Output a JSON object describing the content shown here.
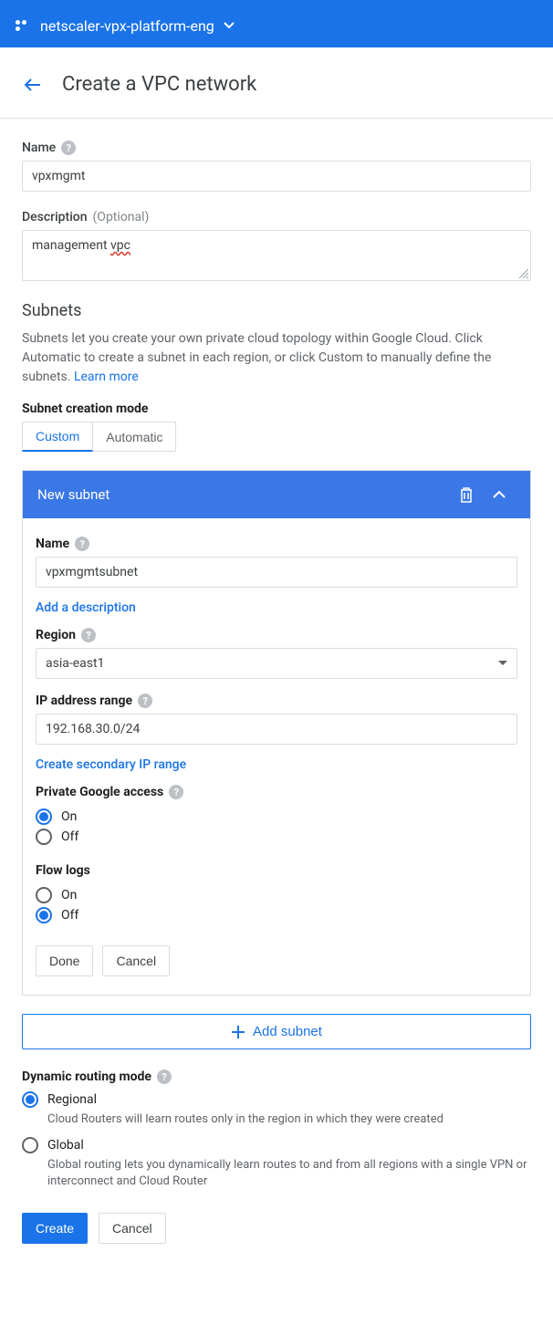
{
  "header": {
    "project": "netscaler-vpx-platform-eng",
    "page_title": "Create a VPC network"
  },
  "name_field": {
    "label": "Name",
    "value": "vpxmgmt"
  },
  "description_field": {
    "label": "Description",
    "optional": "(Optional)",
    "value_pre": "management ",
    "value_err": "vpc"
  },
  "subnets": {
    "title": "Subnets",
    "help": "Subnets let you create your own private cloud topology within Google Cloud. Click Automatic to create a subnet in each region, or click Custom to manually define the subnets. ",
    "learn_more": "Learn more",
    "mode_label": "Subnet creation mode",
    "mode_custom": "Custom",
    "mode_automatic": "Automatic"
  },
  "new_subnet": {
    "header": "New subnet",
    "name_label": "Name",
    "name_value": "vpxmgmtsubnet",
    "add_desc": "Add a description",
    "region_label": "Region",
    "region_value": "asia-east1",
    "ip_label": "IP address range",
    "ip_value": "192.168.30.0/24",
    "secondary": "Create secondary IP range",
    "pga_label": "Private Google access",
    "on": "On",
    "off": "Off",
    "flow_label": "Flow logs",
    "done": "Done",
    "cancel": "Cancel"
  },
  "add_subnet": "Add subnet",
  "routing": {
    "label": "Dynamic routing mode",
    "regional": "Regional",
    "regional_desc": "Cloud Routers will learn routes only in the region in which they were created",
    "global": "Global",
    "global_desc": "Global routing lets you dynamically learn routes to and from all regions with a single VPN or interconnect and Cloud Router"
  },
  "final": {
    "create": "Create",
    "cancel": "Cancel"
  }
}
